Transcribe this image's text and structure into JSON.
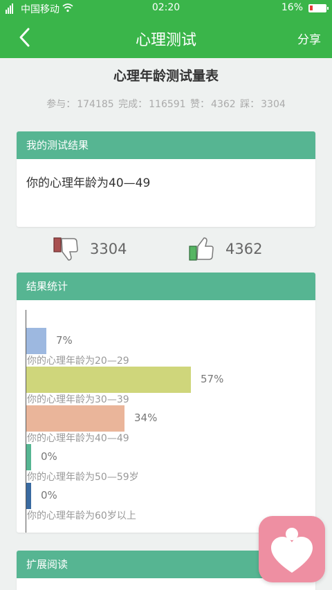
{
  "status_bar": {
    "carrier": "中国移动",
    "time": "02:20",
    "battery": "16%"
  },
  "nav": {
    "title": "心理测试",
    "share_label": "分享"
  },
  "test": {
    "title": "心理年龄测试量表",
    "stats": {
      "participate_label": "参与：",
      "participate": "174185",
      "complete_label": "完成：",
      "complete": "116591",
      "like_label": "赞：",
      "like": "4362",
      "dislike_label": "踩：",
      "dislike": "3304"
    }
  },
  "my_result": {
    "header": "我的测试结果",
    "text": "你的心理年龄为40—49"
  },
  "votes": {
    "dislike_count": "3304",
    "like_count": "4362"
  },
  "result_stats": {
    "header": "结果统计"
  },
  "chart_data": {
    "type": "bar",
    "orientation": "horizontal",
    "categories": [
      "你的心理年龄为20—29",
      "你的心理年龄为30—39",
      "你的心理年龄为40—49",
      "你的心理年龄为50—59岁",
      "你的心理年龄为60岁以上"
    ],
    "values": [
      7,
      57,
      34,
      0,
      0
    ],
    "value_labels": [
      "7%",
      "57%",
      "34%",
      "0%",
      "0%"
    ],
    "colors": [
      "#9db8e0",
      "#cfd67b",
      "#eab59a",
      "#56b592",
      "#3a6aa0"
    ],
    "xlim": [
      0,
      100
    ]
  },
  "more": {
    "header": "扩展阅读"
  }
}
